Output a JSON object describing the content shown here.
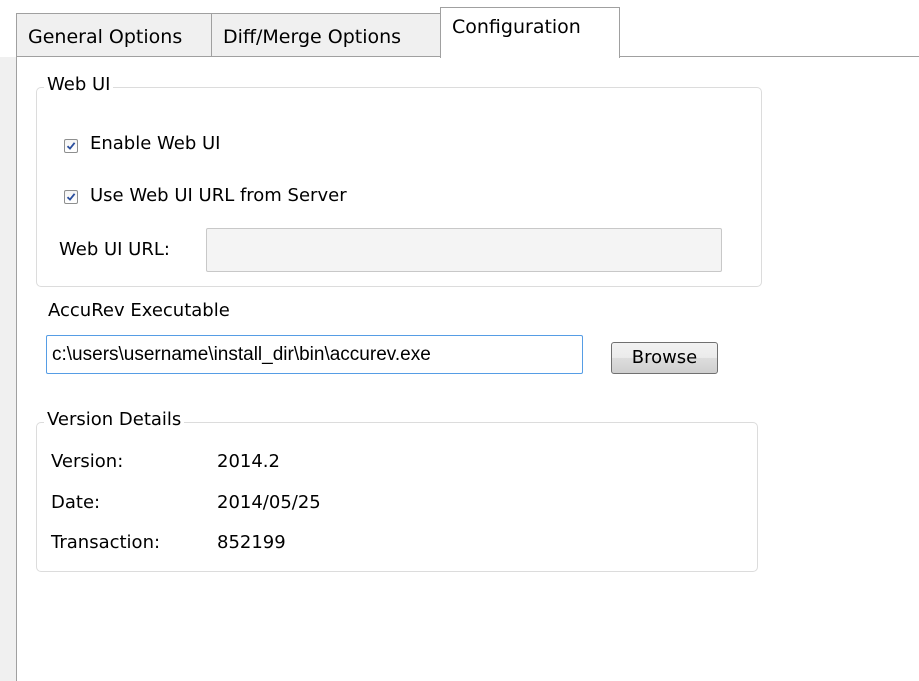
{
  "tabs": [
    {
      "label": "General Options",
      "active": false
    },
    {
      "label": "Diff/Merge Options",
      "active": false
    },
    {
      "label": "Configuration",
      "active": true
    }
  ],
  "web_ui": {
    "group_title": "Web UI",
    "enable_label": "Enable Web UI",
    "enable_checked": true,
    "use_server_url_label": "Use Web UI URL from Server",
    "use_server_url_checked": true,
    "url_label": "Web UI URL:",
    "url_value": ""
  },
  "executable": {
    "label": "AccuRev Executable",
    "path_value": "c:\\users\\username\\install_dir\\bin\\accurev.exe",
    "browse_label": "Browse"
  },
  "version_details": {
    "group_title": "Version Details",
    "version_label": "Version:",
    "version_value": "2014.2",
    "date_label": "Date:",
    "date_value": "2014/05/25",
    "transaction_label": "Transaction:",
    "transaction_value": "852199"
  },
  "colors": {
    "checkmark": "#2b4f9e",
    "focus_border": "#569de5"
  }
}
